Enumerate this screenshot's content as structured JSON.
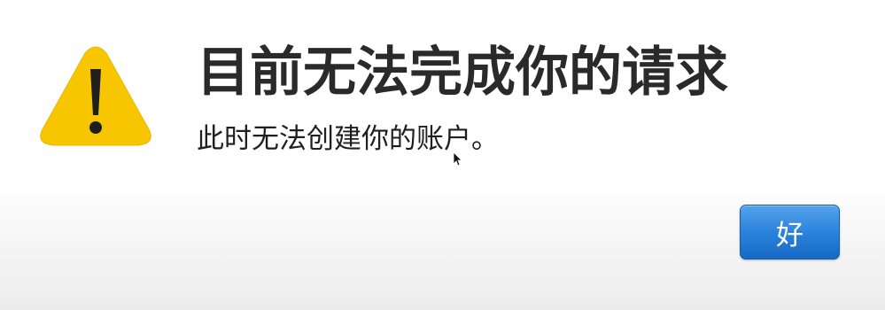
{
  "dialog": {
    "title": "目前无法完成你的请求",
    "message": "此时无法创建你的账户。",
    "icon": "warning-icon",
    "buttons": {
      "ok_label": "好"
    }
  },
  "colors": {
    "warning_yellow": "#f7c600",
    "button_blue": "#2b83dc",
    "title_text": "#2a2a2a"
  }
}
